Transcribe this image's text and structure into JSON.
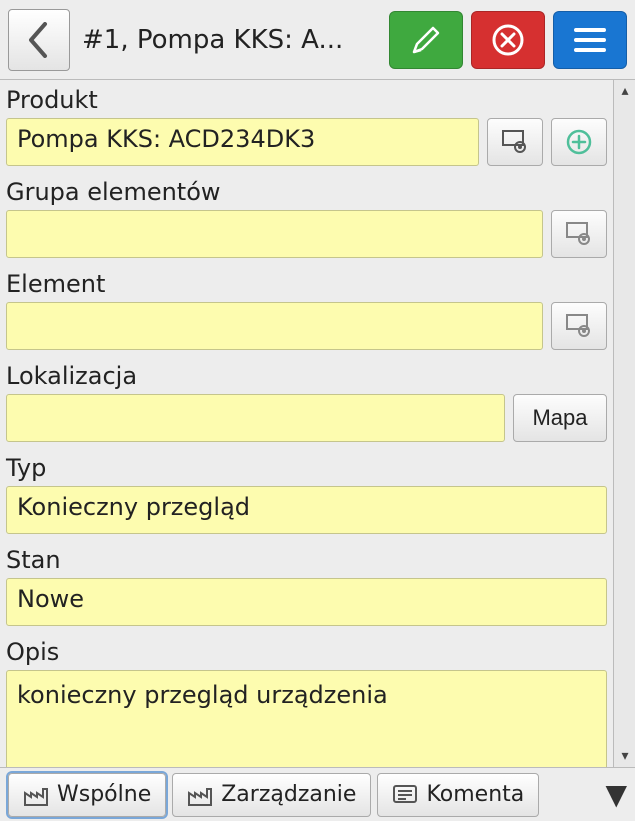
{
  "header": {
    "title": "#1, Pompa KKS: A..."
  },
  "fields": {
    "product": {
      "label": "Produkt",
      "value": "Pompa KKS: ACD234DK3"
    },
    "group": {
      "label": "Grupa elementów",
      "value": ""
    },
    "element": {
      "label": "Element",
      "value": ""
    },
    "location": {
      "label": "Lokalizacja",
      "value": "",
      "map_button": "Mapa"
    },
    "type": {
      "label": "Typ",
      "value": "Konieczny przegląd"
    },
    "state": {
      "label": "Stan",
      "value": "Nowe"
    },
    "desc": {
      "label": "Opis",
      "value": "konieczny przegląd urządzenia"
    }
  },
  "tabs": {
    "a": "Wspólne",
    "b": "Zarządzanie",
    "c": "Komenta"
  }
}
